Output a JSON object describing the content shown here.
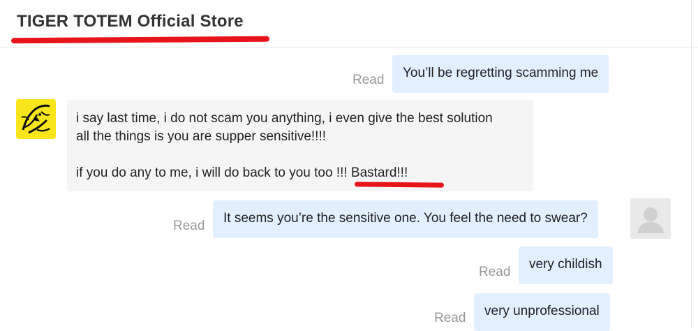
{
  "header": {
    "store_name": "TIGER TOTEM Official Store"
  },
  "messages": [
    {
      "side": "out",
      "status": "Read",
      "text": "You’ll be regretting scamming me"
    },
    {
      "side": "in",
      "lines": [
        "i say last time, i do not scam you anything, i even give the best solution",
        "all the things is you are supper sensitive!!!!",
        "if you do any to me, i will do back to you too ",
        "!!! Bastard!!!"
      ]
    },
    {
      "side": "out",
      "status": "Read",
      "text": "It seems you’re the sensitive one. You feel the need to swear?"
    },
    {
      "side": "out",
      "status": "Read",
      "text": "very childish"
    },
    {
      "side": "out",
      "status": "Read",
      "text": "very unprofessional"
    }
  ],
  "icons": {
    "seller_avatar": "tiger-logo-icon",
    "user_avatar": "default-user-icon"
  },
  "colors": {
    "outgoing_bubble": "#e1efff",
    "incoming_bubble": "#f5f5f5",
    "annotation": "#e8141b",
    "avatar_bg": "#f8e51c"
  }
}
